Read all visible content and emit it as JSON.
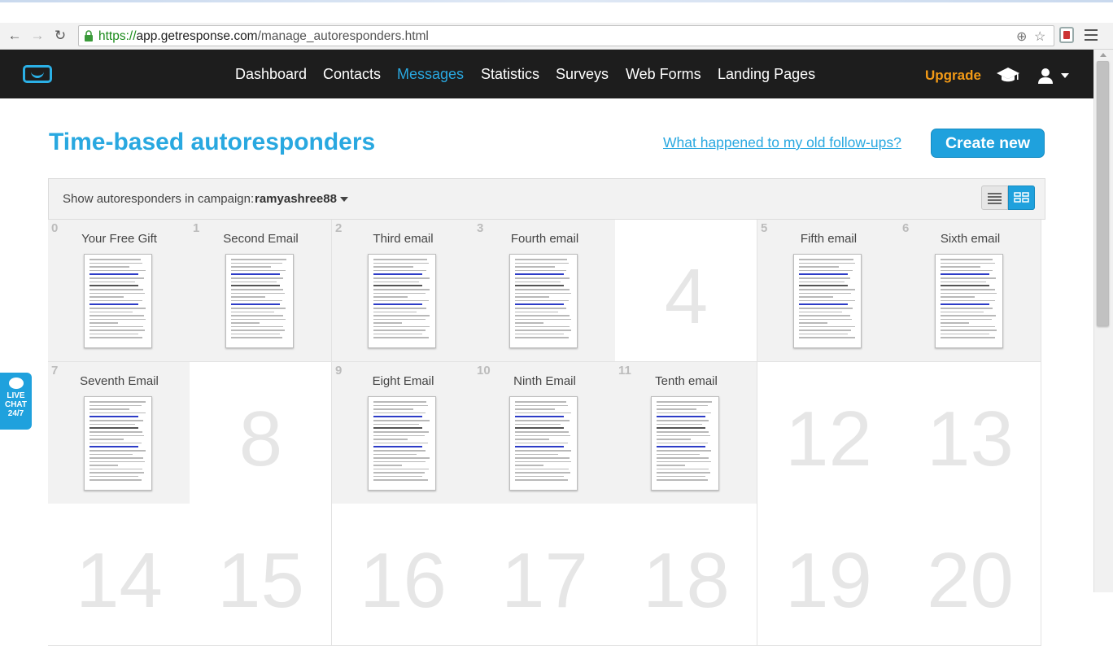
{
  "browser": {
    "url_scheme": "https://",
    "url_host": "app.getresponse.com",
    "url_path": "/manage_autoresponders.html"
  },
  "nav": {
    "items": [
      "Dashboard",
      "Contacts",
      "Messages",
      "Statistics",
      "Surveys",
      "Web Forms",
      "Landing Pages"
    ],
    "active": "Messages",
    "upgrade": "Upgrade"
  },
  "page": {
    "title": "Time-based autoresponders",
    "followups_link": "What happened to my old follow-ups?",
    "create_button": "Create new",
    "filter_label": "Show autoresponders in campaign:",
    "campaign": "ramyashree88"
  },
  "cells": [
    {
      "day": "0",
      "name": "Your Free Gift"
    },
    {
      "day": "1",
      "name": "Second Email"
    },
    {
      "day": "2",
      "name": "Third email"
    },
    {
      "day": "3",
      "name": "Fourth email"
    },
    {
      "day": "4",
      "name": ""
    },
    {
      "day": "5",
      "name": "Fifth email"
    },
    {
      "day": "6",
      "name": "Sixth email"
    },
    {
      "day": "7",
      "name": "Seventh Email"
    },
    {
      "day": "8",
      "name": ""
    },
    {
      "day": "9",
      "name": "Eight Email"
    },
    {
      "day": "10",
      "name": "Ninth Email"
    },
    {
      "day": "11",
      "name": "Tenth email"
    },
    {
      "day": "12",
      "name": ""
    },
    {
      "day": "13",
      "name": ""
    },
    {
      "day": "14",
      "name": ""
    },
    {
      "day": "15",
      "name": ""
    },
    {
      "day": "16",
      "name": ""
    },
    {
      "day": "17",
      "name": ""
    },
    {
      "day": "18",
      "name": ""
    },
    {
      "day": "19",
      "name": ""
    },
    {
      "day": "20",
      "name": ""
    }
  ],
  "livechat": {
    "line1": "LIVE",
    "line2": "CHAT",
    "line3": "24/7"
  },
  "colors": {
    "accent": "#29a8e0",
    "upgrade": "#f39a16",
    "navbar": "#1d1d1d"
  }
}
